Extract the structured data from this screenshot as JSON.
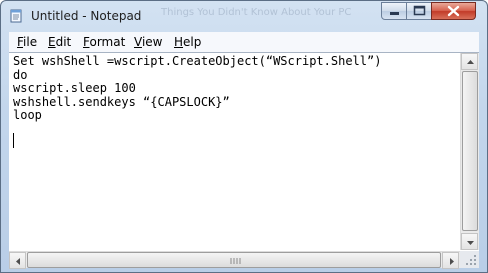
{
  "window": {
    "title": "Untitled - Notepad",
    "background_title_text": "Things You Didn't Know About Your PC"
  },
  "menu": [
    {
      "label": "File",
      "mnemonic": "F",
      "rest": "ile"
    },
    {
      "label": "Edit",
      "mnemonic": "E",
      "rest": "dit"
    },
    {
      "label": "Format",
      "mnemonic": "F",
      "rest": "ormat"
    },
    {
      "label": "View",
      "mnemonic": "V",
      "rest": "iew"
    },
    {
      "label": "Help",
      "mnemonic": "H",
      "rest": "elp"
    }
  ],
  "editor": {
    "lines": [
      "Set wshShell =wscript.CreateObject(“WScript.Shell”)",
      "do",
      "wscript.sleep 100",
      "wshshell.sendkeys “{CAPSLOCK}”",
      "loop",
      ""
    ]
  },
  "icons": {
    "app": "notepad-icon",
    "minimize": "minimize-icon",
    "maximize": "maximize-icon",
    "close": "close-icon",
    "scroll_up": "arrow-up-icon",
    "scroll_down": "arrow-down-icon",
    "scroll_left": "arrow-left-icon",
    "scroll_right": "arrow-right-icon",
    "grip": "size-grip-icon"
  },
  "colors": {
    "close_button": "#c23b28",
    "frame": "#c3d6ec",
    "editor_bg": "#ffffff"
  }
}
